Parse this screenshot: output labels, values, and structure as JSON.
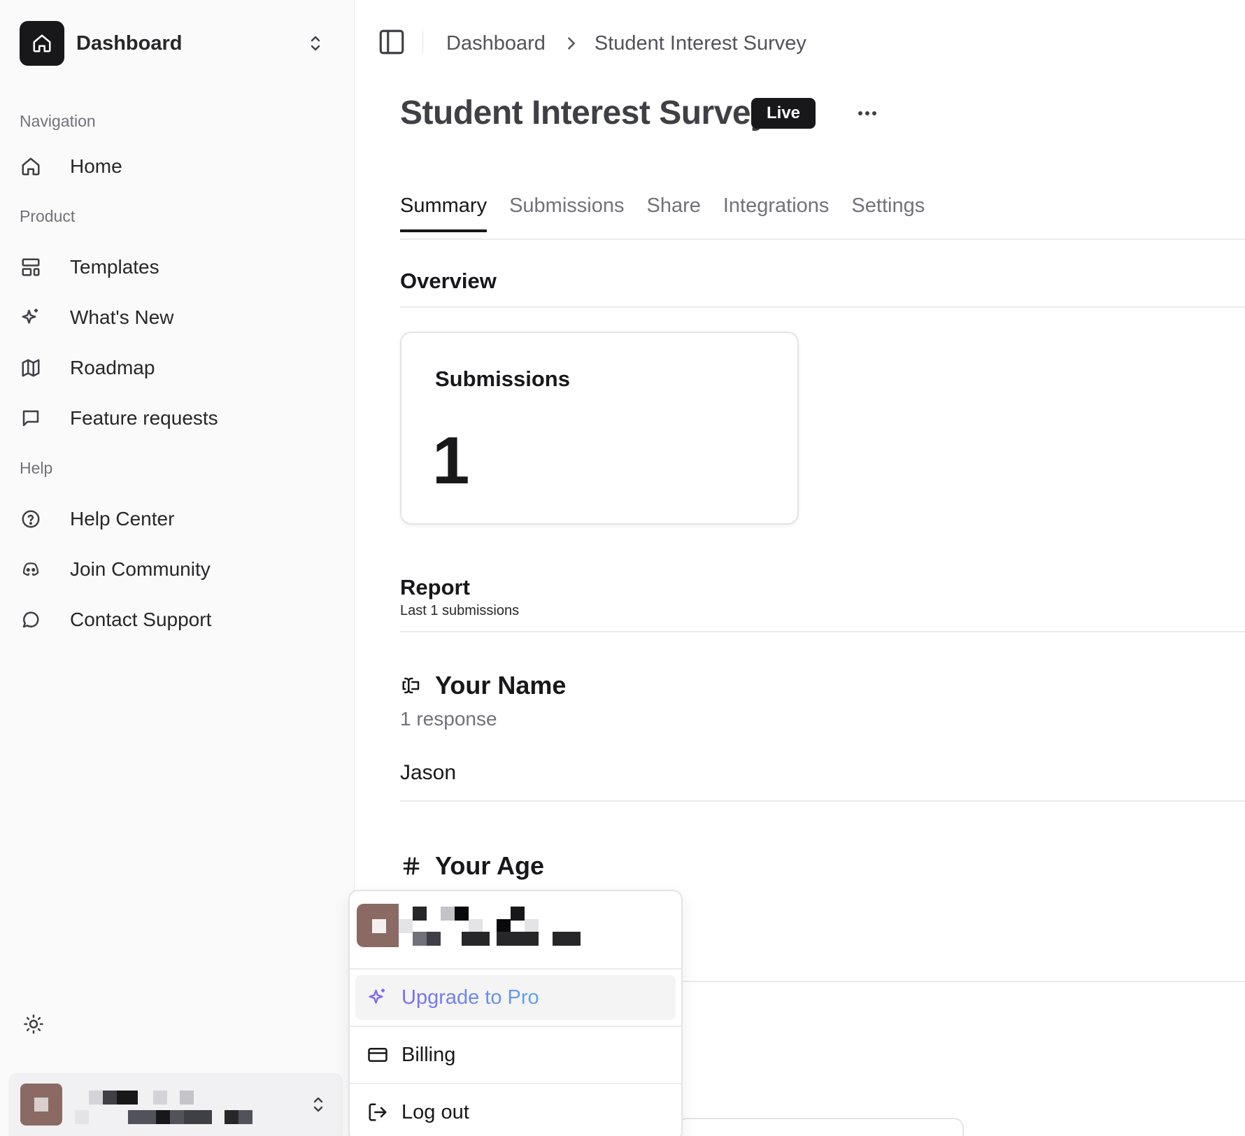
{
  "sidebar": {
    "workspace": {
      "name": "Dashboard"
    },
    "sections": [
      {
        "label": "Navigation"
      },
      {
        "label": "Product"
      },
      {
        "label": "Help"
      }
    ],
    "items": [
      {
        "label": "Home",
        "icon": "home-icon"
      },
      {
        "label": "Templates",
        "icon": "layout-template-icon"
      },
      {
        "label": "What's New",
        "icon": "sparkles-icon"
      },
      {
        "label": "Roadmap",
        "icon": "map-icon"
      },
      {
        "label": "Feature requests",
        "icon": "message-square-icon"
      },
      {
        "label": "Help Center",
        "icon": "help-circle-icon"
      },
      {
        "label": "Join Community",
        "icon": "discord-icon"
      },
      {
        "label": "Contact Support",
        "icon": "message-circle-icon"
      }
    ]
  },
  "header": {
    "breadcrumb": [
      "Dashboard",
      "Student Interest Survey"
    ]
  },
  "page": {
    "title": "Student Interest Survey",
    "status_badge": "Live",
    "tabs": [
      "Summary",
      "Submissions",
      "Share",
      "Integrations",
      "Settings"
    ],
    "active_tab": "Summary"
  },
  "overview": {
    "title": "Overview",
    "card": {
      "label": "Submissions",
      "value": "1"
    }
  },
  "report": {
    "title": "Report",
    "subtitle": "Last 1 submissions",
    "questions": [
      {
        "title": "Your Name",
        "icon": "text-cursor-input-icon",
        "count": "1 response",
        "answers": [
          "Jason"
        ]
      },
      {
        "title": "Your Age",
        "icon": "hash-icon"
      }
    ]
  },
  "user_menu": {
    "items": [
      {
        "label": "Upgrade to Pro",
        "icon": "sparkles-icon"
      },
      {
        "label": "Billing",
        "icon": "credit-card-icon"
      },
      {
        "label": "Log out",
        "icon": "log-out-icon"
      }
    ]
  },
  "colors": {
    "accent": "#18181b",
    "upgrade_gradient_start": "#7c6cf0",
    "upgrade_gradient_end": "#5ba4e6"
  }
}
